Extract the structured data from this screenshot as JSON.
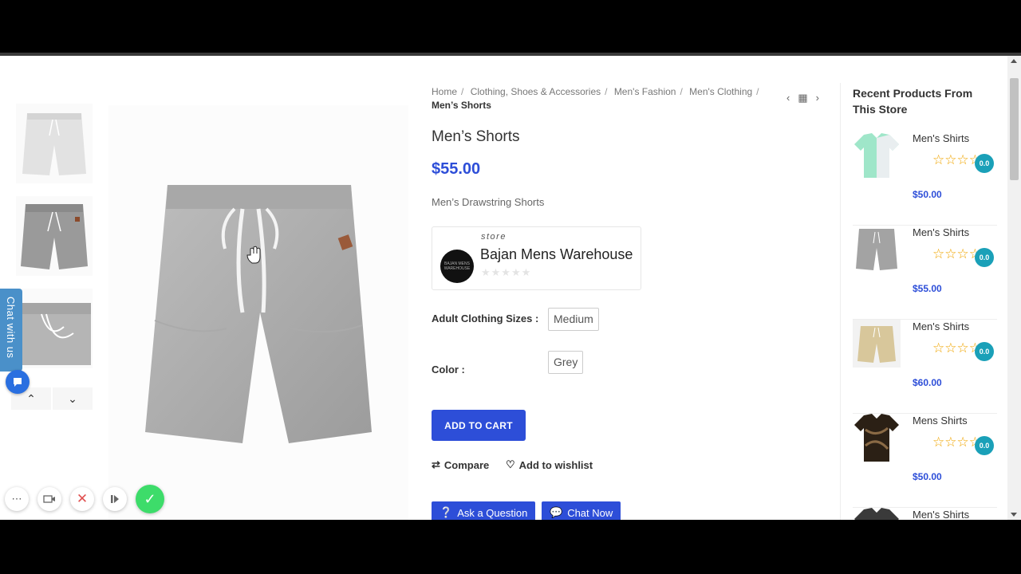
{
  "breadcrumb": [
    "Home",
    "Clothing, Shoes & Accessories",
    "Men's Fashion",
    "Men's Clothing"
  ],
  "breadcrumb_current": "Men’s Shorts",
  "product": {
    "title": "Men’s Shorts",
    "price": "$55.00",
    "description": "Men’s Drawstring  Shorts"
  },
  "store": {
    "label": "store",
    "name": "Bajan Mens Warehouse",
    "rating_stars": "★★★★★",
    "logo_text": "BAJAN MENS WAREHOUSE"
  },
  "attributes": [
    {
      "label": "Adult Clothing Sizes :",
      "value": "Medium"
    },
    {
      "label": "Color :",
      "value": "Grey"
    }
  ],
  "actions": {
    "add_to_cart": "ADD TO CART",
    "compare": "Compare",
    "wishlist": "Add to wishlist",
    "ask_question": "Ask a Question",
    "chat_now": "Chat Now"
  },
  "chat_tab": "Chat with us",
  "sidebar": {
    "title": "Recent Products From This Store",
    "items": [
      {
        "name": "Men's Shirts",
        "price": "$50.00",
        "rating": "0.0",
        "stars": "☆☆☆☆☆"
      },
      {
        "name": "Men's Shirts",
        "price": "$55.00",
        "rating": "0.0",
        "stars": "☆☆☆☆☆"
      },
      {
        "name": "Men's Shirts",
        "price": "$60.00",
        "rating": "0.0",
        "stars": "☆☆☆☆☆"
      },
      {
        "name": "Mens Shirts",
        "price": "$50.00",
        "rating": "0.0",
        "stars": "☆☆☆☆☆"
      },
      {
        "name": "Men's Shirts"
      }
    ]
  },
  "colors": {
    "accent": "#2d4ed8",
    "badge": "#1aa0b8",
    "star": "#f0a500",
    "chat_tab": "#4a90c9",
    "confirm": "#3ddc6a"
  }
}
